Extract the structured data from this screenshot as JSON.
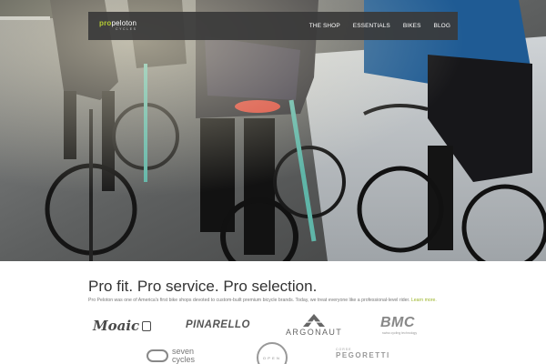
{
  "nav": {
    "logo_pro": "pro",
    "logo_rest": "peloton",
    "logo_sub": "CYCLES",
    "items": [
      {
        "label": "THE SHOP"
      },
      {
        "label": "ESSENTIALS"
      },
      {
        "label": "BIKES"
      },
      {
        "label": "BLOG"
      }
    ]
  },
  "content": {
    "headline": "Pro fit. Pro service. Pro selection.",
    "blurb": "Pro Peloton was one of America's first bike shops devoted to custom-built premium bicycle brands. Today, we treat everyone like a professional-level rider.",
    "learn_more": "Learn more."
  },
  "brands": {
    "moaic": "Moaic",
    "pinarello": "PINARELLO",
    "argonaut": "ARGONAUT",
    "bmc": "BMC",
    "bmc_tag": "swiss cycling technology",
    "seven": "seven\ncycles",
    "seven_line1": "seven",
    "seven_line2": "cycles",
    "open": "OPEN",
    "peg_small": "CORSE",
    "pegoretti": "PEGORETTI"
  },
  "colors": {
    "accent_green": "#b5cc34",
    "nav_bg": "#3a3a3a",
    "headline": "#333333",
    "link": "#9cb52a"
  }
}
